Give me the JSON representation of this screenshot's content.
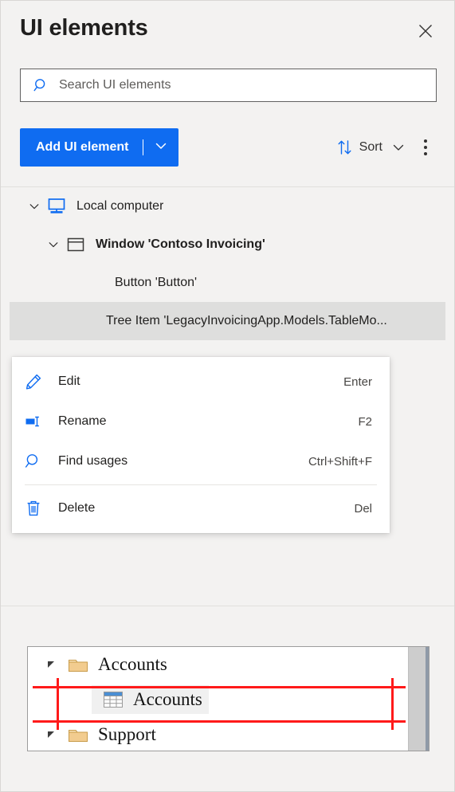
{
  "header": {
    "title": "UI elements",
    "close_label": "Close",
    "close_icon": "close-icon"
  },
  "search": {
    "placeholder": "Search UI elements",
    "value": "",
    "icon": "search-icon"
  },
  "toolbar": {
    "add_label": "Add UI element",
    "add_caret_icon": "chevron-down-icon",
    "sort_label": "Sort",
    "sort_icon": "sort-arrows-icon",
    "sort_caret_icon": "chevron-down-icon",
    "more_label": "More commands",
    "more_icon": "more-vertical-icon"
  },
  "tree": {
    "items": [
      {
        "label": "Local computer",
        "icon": "monitor-icon",
        "chevron": "chevron-down-icon",
        "indent": 0,
        "bold": false,
        "selected": false
      },
      {
        "label": "Window 'Contoso Invoicing'",
        "icon": "window-icon",
        "chevron": "chevron-down-icon",
        "indent": 1,
        "bold": true,
        "selected": false
      },
      {
        "label": "Button 'Button'",
        "icon": "",
        "chevron": "",
        "indent": 2,
        "bold": false,
        "selected": false
      },
      {
        "label": "Tree Item 'LegacyInvoicingApp.Models.TableMo...",
        "icon": "",
        "chevron": "",
        "indent": 2,
        "bold": false,
        "selected": true
      }
    ]
  },
  "context_menu": {
    "items": [
      {
        "label": "Edit",
        "shortcut": "Enter",
        "icon": "pencil-icon",
        "separator_after": false
      },
      {
        "label": "Rename",
        "shortcut": "F2",
        "icon": "rename-icon",
        "separator_after": false
      },
      {
        "label": "Find usages",
        "shortcut": "Ctrl+Shift+F",
        "icon": "search-icon",
        "separator_after": true
      },
      {
        "label": "Delete",
        "shortcut": "Del",
        "icon": "trash-icon",
        "separator_after": false
      }
    ]
  },
  "preview": {
    "rows": [
      {
        "label": "Accounts",
        "icon": "folder-icon",
        "arrow": "expand-arrow-icon",
        "level": 0
      },
      {
        "label": "Accounts",
        "icon": "table-grid-icon",
        "arrow": "",
        "level": 1
      },
      {
        "label": "Support",
        "icon": "folder-icon",
        "arrow": "expand-arrow-icon",
        "level": 0
      }
    ],
    "highlight_color": "#ff1a1a"
  },
  "colors": {
    "accent": "#0f6cf1",
    "panel_bg": "#f3f2f1",
    "selected_row": "#dededd",
    "text": "#201f1e"
  }
}
